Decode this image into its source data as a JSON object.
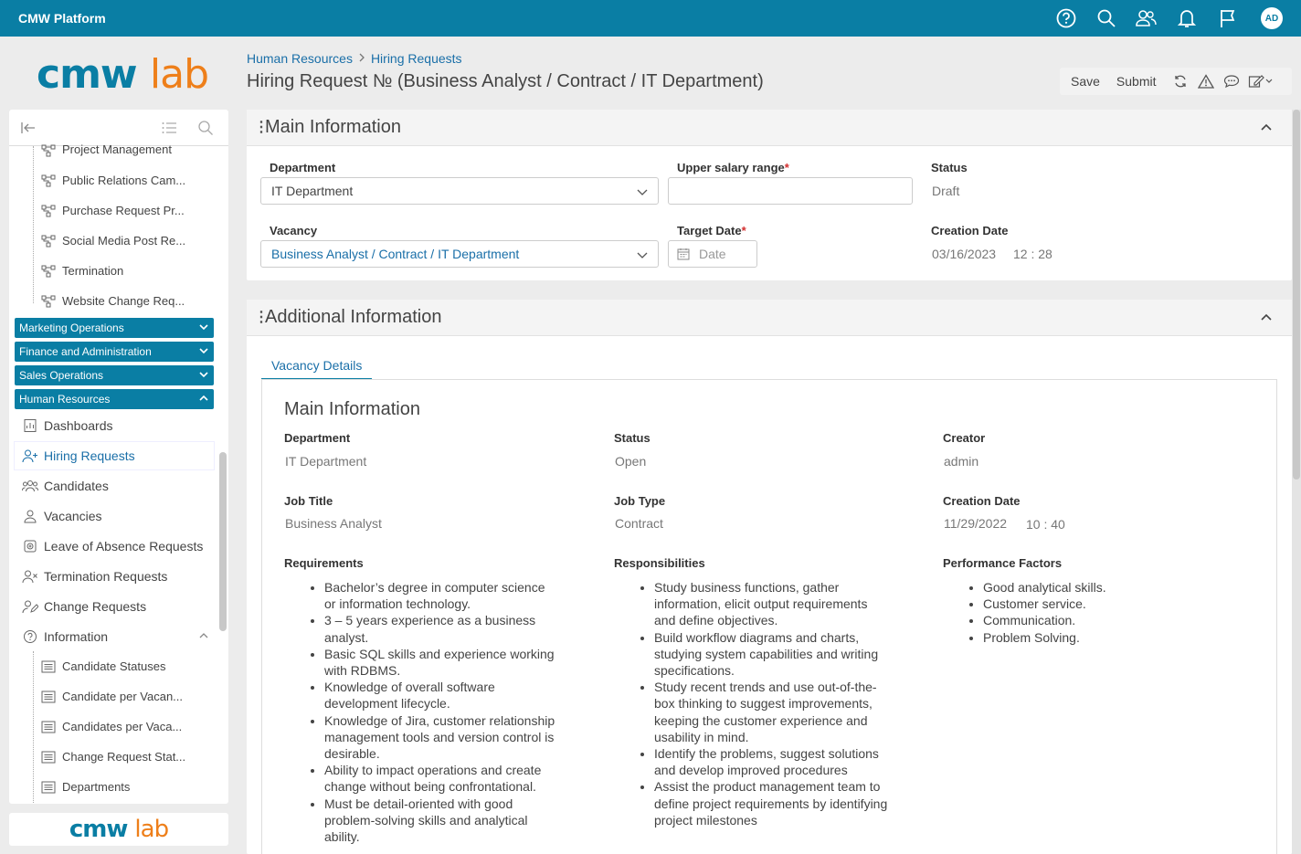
{
  "app": {
    "title": "CMW Platform",
    "user_initials": "AD",
    "brand_color": "#0a7ea4",
    "accent_color": "#ee7f1a"
  },
  "logo": {
    "part1": "cmw",
    "part2": "lab"
  },
  "topbar_icons": [
    "help-icon",
    "search-icon",
    "users-icon",
    "bell-icon",
    "flag-icon"
  ],
  "breadcrumb": {
    "items": [
      "Human Resources",
      "Hiring Requests"
    ]
  },
  "page": {
    "title": "Hiring Request № (Business Analyst / Contract / IT Department)"
  },
  "actions": {
    "save": "Save",
    "submit": "Submit"
  },
  "sidebar": {
    "tree_items": [
      "Project Management",
      "Public Relations Cam...",
      "Purchase Request Pr...",
      "Social Media Post Re...",
      "Termination",
      "Website Change Req..."
    ],
    "groups": [
      "Marketing Operations",
      "Finance and Administration",
      "Sales Operations",
      "Human Resources"
    ],
    "hr_items": [
      "Dashboards",
      "Hiring Requests",
      "Candidates",
      "Vacancies",
      "Leave of Absence Requests",
      "Termination Requests",
      "Change Requests",
      "Information"
    ],
    "info_items": [
      "Candidate Statuses",
      "Candidate per Vacan...",
      "Candidates per Vaca...",
      "Change Request Stat...",
      "Departments"
    ]
  },
  "main_info": {
    "title": "Main Information",
    "department_label": "Department",
    "department_value": "IT Department",
    "salary_label": "Upper salary range",
    "salary_value": "",
    "status_label": "Status",
    "status_value": "Draft",
    "vacancy_label": "Vacancy",
    "vacancy_value": "Business Analyst / Contract / IT Department",
    "target_date_label": "Target Date",
    "target_date_placeholder": "Date",
    "creation_date_label": "Creation Date",
    "creation_date_value": "03/16/2023",
    "creation_time_value": "12 : 28",
    "required_mark": "*"
  },
  "additional_info": {
    "title": "Additional Information",
    "tab": "Vacancy Details",
    "section_title": "Main Information",
    "department_label": "Department",
    "department_value": "IT Department",
    "status_label": "Status",
    "status_value": "Open",
    "creator_label": "Creator",
    "creator_value": "admin",
    "job_title_label": "Job Title",
    "job_title_value": "Business Analyst",
    "job_type_label": "Job Type",
    "job_type_value": "Contract",
    "creation_date_label": "Creation Date",
    "creation_date_value": "11/29/2022",
    "creation_time_value": "10 : 40",
    "requirements_label": "Requirements",
    "responsibilities_label": "Responsibilities",
    "performance_label": "Performance Factors",
    "requirements": [
      "Bachelor’s degree in computer science or information technology.",
      "3 – 5 years experience as a business analyst.",
      "Basic SQL skills and experience working with RDBMS.",
      "Knowledge of overall software development lifecycle.",
      "Knowledge of Jira, customer relationship management tools and version control is desirable.",
      "Ability to impact operations and create change without being confrontational.",
      "Must be detail-oriented with good problem-solving skills and analytical ability."
    ],
    "responsibilities": [
      "Study business functions, gather information, elicit output requirements and define objectives.",
      "Build workflow diagrams and charts, studying system capabilities and writing specifications.",
      "Study recent trends and use out-of-the-box thinking to suggest improvements, keeping the customer experience and usability in mind.",
      "Identify the problems, suggest solutions and develop improved procedures",
      "Assist the product management team to define project requirements by identifying project milestones"
    ],
    "performance_factors": [
      "Good analytical skills.",
      "Customer service.",
      "Communication.",
      "Problem Solving."
    ]
  }
}
